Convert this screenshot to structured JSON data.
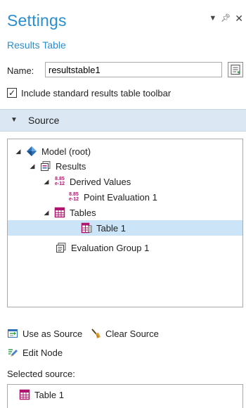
{
  "header": {
    "title": "Settings",
    "subtitle": "Results Table",
    "controls": [
      "dropdown-arrow",
      "pin",
      "close"
    ]
  },
  "name_field": {
    "label": "Name:",
    "value": "resultstable1"
  },
  "toolbar_checkbox": {
    "checked": true,
    "label": "Include standard results table toolbar"
  },
  "source_section": {
    "label": "Source"
  },
  "tree": {
    "nodes": [
      {
        "label": "Model (root)",
        "icon": "model-root-icon",
        "expanded": true
      },
      {
        "label": "Results",
        "icon": "results-icon",
        "expanded": true
      },
      {
        "label": "Derived Values",
        "icon": "derived-values-icon",
        "icon_text": "8.85\ne-12",
        "expanded": true
      },
      {
        "label": "Point Evaluation 1",
        "icon": "point-evaluation-icon",
        "icon_text": "8.85\ne-12"
      },
      {
        "label": "Tables",
        "icon": "tables-icon",
        "expanded": true
      },
      {
        "label": "Table 1",
        "icon": "table-icon",
        "selected": true
      },
      {
        "label": "Evaluation Group 1",
        "icon": "evaluation-group-icon"
      }
    ]
  },
  "actions": {
    "use_as_source": "Use as Source",
    "clear_source": "Clear Source",
    "edit_node": "Edit Node"
  },
  "selected_source": {
    "label": "Selected source:",
    "item": "Table 1"
  },
  "colors": {
    "accent": "#2a8ecf",
    "section_bg": "#dbe7f3",
    "selection": "#cce4f7",
    "table_icon": "#b0166f"
  }
}
